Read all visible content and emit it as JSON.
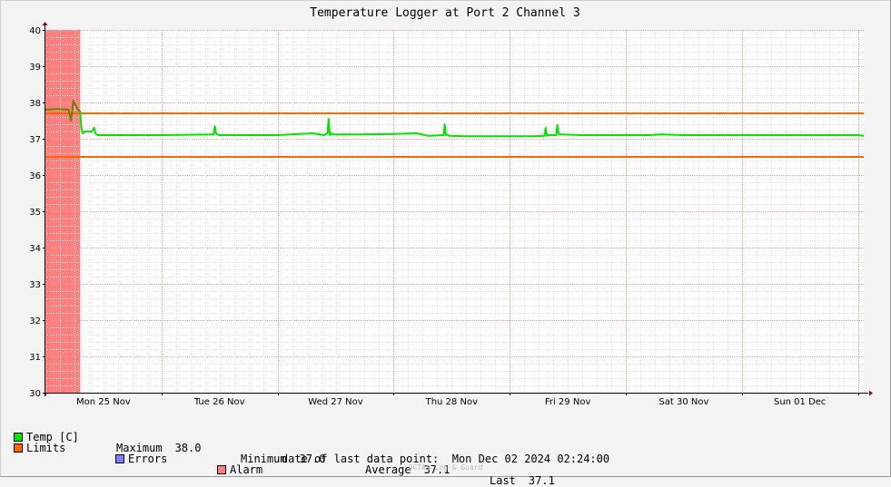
{
  "chart_data": {
    "type": "line",
    "title": "Temperature Logger at Port 2 Channel 3",
    "xlabel": "",
    "ylabel": "",
    "ylim": [
      30,
      40
    ],
    "yticks": [
      30,
      31,
      32,
      33,
      34,
      35,
      36,
      37,
      38,
      39,
      40
    ],
    "x_tick_labels": [
      "Mon 25 Nov",
      "Tue 26 Nov",
      "Wed 27 Nov",
      "Thu 28 Nov",
      "Fri 29 Nov",
      "Sat 30 Nov",
      "Sun 01 Dec"
    ],
    "x_range_days": [
      0,
      7.05
    ],
    "grid": true,
    "limits": [
      37.7,
      36.5
    ],
    "alarm_span_days": [
      0,
      0.3
    ],
    "series": [
      {
        "name": "Temp [C]",
        "color": "#00e600",
        "x": [
          0,
          0.1,
          0.2,
          0.22,
          0.23,
          0.24,
          0.28,
          0.3,
          0.31,
          0.32,
          0.34,
          0.4,
          0.42,
          0.43,
          0.45,
          0.6,
          1.0,
          1.45,
          1.46,
          1.47,
          1.48,
          1.5,
          2.0,
          2.3,
          2.4,
          2.43,
          2.44,
          2.45,
          2.46,
          2.48,
          2.7,
          3.0,
          3.2,
          3.3,
          3.43,
          3.44,
          3.45,
          3.46,
          3.48,
          3.6,
          4.0,
          4.2,
          4.3,
          4.31,
          4.32,
          4.33,
          4.4,
          4.41,
          4.42,
          4.43,
          4.45,
          4.6,
          5.0,
          5.2,
          5.3,
          5.5,
          6.0,
          6.5,
          7.0,
          7.05
        ],
        "values": [
          37.8,
          37.82,
          37.8,
          37.5,
          37.75,
          38.05,
          37.8,
          37.75,
          37.3,
          37.15,
          37.2,
          37.2,
          37.3,
          37.15,
          37.1,
          37.1,
          37.1,
          37.12,
          37.35,
          37.15,
          37.12,
          37.1,
          37.1,
          37.15,
          37.1,
          37.15,
          37.55,
          37.1,
          37.15,
          37.12,
          37.12,
          37.13,
          37.15,
          37.08,
          37.1,
          37.4,
          37.1,
          37.12,
          37.08,
          37.07,
          37.07,
          37.07,
          37.08,
          37.3,
          37.08,
          37.1,
          37.1,
          37.38,
          37.15,
          37.12,
          37.12,
          37.1,
          37.1,
          37.1,
          37.12,
          37.1,
          37.1,
          37.1,
          37.1,
          37.08
        ]
      }
    ]
  },
  "legend": {
    "temp_label": "Temp [C]",
    "maximum_label": "Maximum",
    "maximum_value": "38.0",
    "minimum_label": "Minimum",
    "minimum_value": "37.0",
    "average_label": "Average",
    "average_value": "37.1",
    "last_label": "Last",
    "last_value": "37.1",
    "limits_label": "Limits",
    "errors_label": "Errors",
    "alarm_label": "Alarm",
    "colors": {
      "temp": "#00e600",
      "limits": "#ff6600",
      "errors": "#7f7fff",
      "alarm": "#ff7f7f"
    }
  },
  "footer": {
    "date_label": "date of last data point:",
    "date_value": "Mon Dec 02 2024 02:24:00",
    "credit": "OCTA$ Log & Guard"
  }
}
